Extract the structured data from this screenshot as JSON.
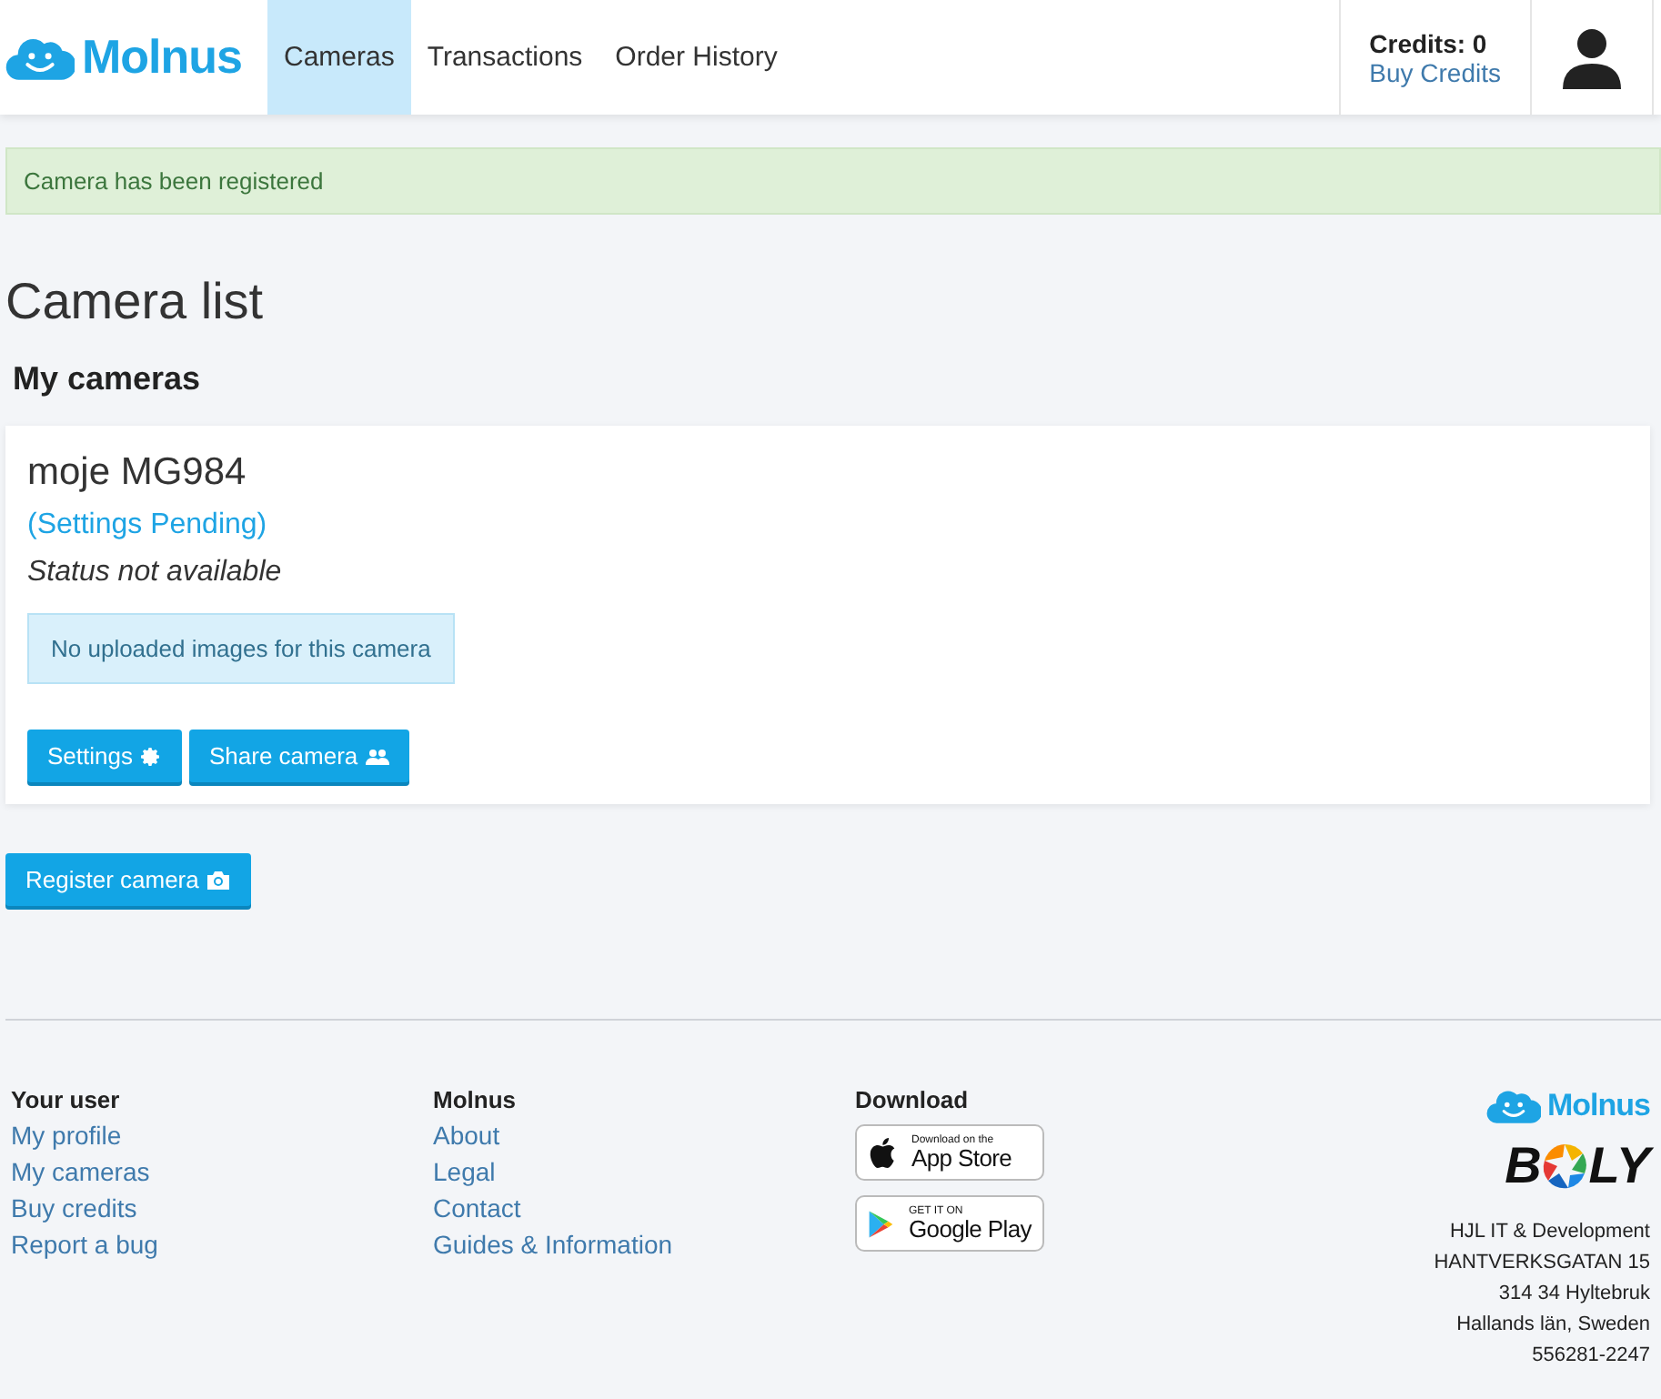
{
  "header": {
    "brand": "Molnus",
    "nav": [
      {
        "label": "Cameras",
        "selected": true
      },
      {
        "label": "Transactions",
        "selected": false
      },
      {
        "label": "Order History",
        "selected": false
      }
    ],
    "credits": "Credits: 0",
    "buy_credits": "Buy Credits"
  },
  "alert": "Camera has been registered",
  "title": "Camera list",
  "section": "My cameras",
  "cameras": [
    {
      "name": "moje MG984",
      "settings_status": "(Settings Pending)",
      "status": "Status not available",
      "images_note": "No uploaded images for this camera",
      "buttons": [
        {
          "label": "Settings",
          "kind": "settings"
        },
        {
          "label": "Share camera",
          "kind": "share"
        }
      ]
    }
  ],
  "register_button": "Register camera",
  "footer": {
    "columns": [
      {
        "heading": "Your user",
        "links": [
          "My profile",
          "My cameras",
          "Buy credits",
          "Report a bug"
        ]
      },
      {
        "heading": "Molnus",
        "links": [
          "About",
          "Legal",
          "Contact",
          "Guides & Information"
        ]
      }
    ],
    "download": {
      "heading": "Download",
      "badges": [
        {
          "kind": "apple",
          "small": "Download on the",
          "big": "App Store"
        },
        {
          "kind": "google",
          "small": "GET IT ON",
          "big": "Google Play"
        }
      ]
    },
    "brand": "Molnus",
    "partner": {
      "start": "B",
      "end": "LY"
    },
    "address": [
      "HJL IT & Development",
      "HANTVERKSGATAN 15",
      "314 34 Hyltebruk",
      "Hallands län, Sweden",
      "556281-2247"
    ]
  }
}
